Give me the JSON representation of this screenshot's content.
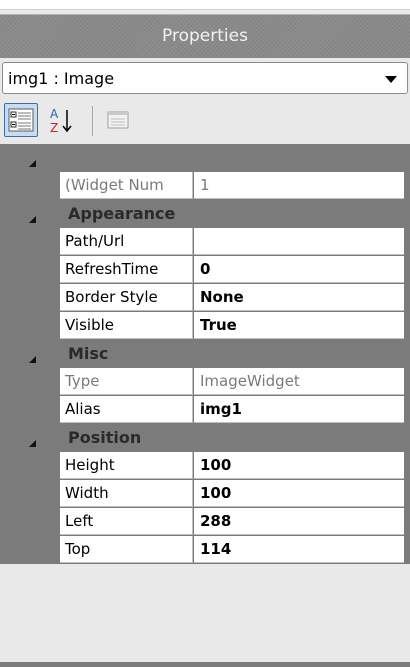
{
  "panel": {
    "title": "Properties"
  },
  "selector": {
    "value": "img1 : Image"
  },
  "toolbar": {
    "categorized_icon": "categorized-icon",
    "alphabetical_icon": "alphabetical-sort-icon",
    "property_pages_icon": "property-pages-icon"
  },
  "categories": [
    {
      "label": "",
      "props": [
        {
          "name": "(Widget Num",
          "value": "1",
          "bold": false,
          "readonly": true
        }
      ]
    },
    {
      "label": "Appearance",
      "props": [
        {
          "name": "Path/Url",
          "value": "",
          "bold": false,
          "readonly": false
        },
        {
          "name": "RefreshTime",
          "value": "0",
          "bold": true,
          "readonly": false
        },
        {
          "name": "Border Style",
          "value": "None",
          "bold": true,
          "readonly": false
        },
        {
          "name": "Visible",
          "value": "True",
          "bold": true,
          "readonly": false
        }
      ]
    },
    {
      "label": "Misc",
      "props": [
        {
          "name": "Type",
          "value": "ImageWidget",
          "bold": false,
          "readonly": true
        },
        {
          "name": "Alias",
          "value": "img1",
          "bold": true,
          "readonly": false
        }
      ]
    },
    {
      "label": "Position",
      "props": [
        {
          "name": "Height",
          "value": "100",
          "bold": true,
          "readonly": false
        },
        {
          "name": "Width",
          "value": "100",
          "bold": true,
          "readonly": false
        },
        {
          "name": "Left",
          "value": "288",
          "bold": true,
          "readonly": false
        },
        {
          "name": "Top",
          "value": "114",
          "bold": true,
          "readonly": false
        }
      ]
    }
  ],
  "colors": {
    "header": "#8a8a8a",
    "category_bg": "#7b7b7b",
    "cell_bg": "#ffffff",
    "toolbar_active": "#c8dcf0"
  }
}
